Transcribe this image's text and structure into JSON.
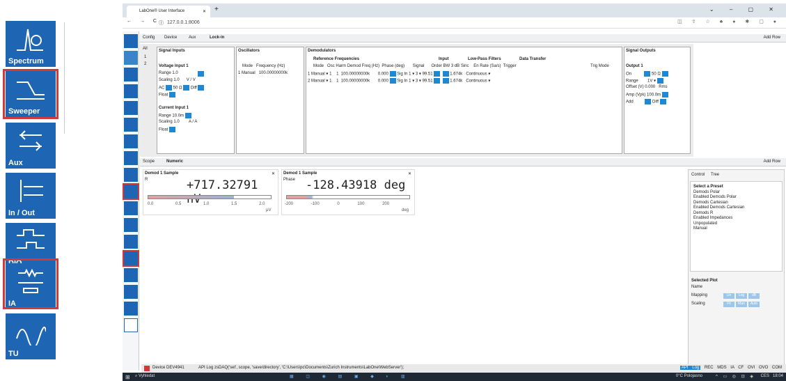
{
  "zoom_sidebar": {
    "items": [
      {
        "label": "Spectrum",
        "icon": "spectrum-icon",
        "highlighted": false
      },
      {
        "label": "Sweeper",
        "icon": "sweeper-icon",
        "highlighted": true
      },
      {
        "label": "Aux",
        "icon": "aux-icon",
        "highlighted": false
      },
      {
        "label": "In / Out",
        "icon": "in-out-icon",
        "highlighted": false
      },
      {
        "label": "DIO",
        "icon": "dio-icon",
        "highlighted": false
      },
      {
        "label": "IA",
        "icon": "ia-icon",
        "highlighted": true
      },
      {
        "label": "TU",
        "icon": "tu-icon",
        "highlighted": false
      }
    ]
  },
  "browser": {
    "tab_title": "LabOne® User Interface",
    "url": "127.0.0.1:8006"
  },
  "top_tabs": {
    "items": [
      "Config",
      "Device",
      "Aux",
      "Lock-in"
    ],
    "add_row": "Add Row"
  },
  "lockin": {
    "all": "All",
    "row1": "1",
    "row2": "2",
    "signal_inputs": {
      "title": "Signal Inputs",
      "voltage_input": "Voltage Input 1",
      "range_label": "Range",
      "range_val": "1.0",
      "scaling_label": "Scaling",
      "scaling_val": "1.0",
      "scaling_unit": "V / V",
      "ac": "AC",
      "ohm": "50 Ω",
      "diff": "Diff",
      "float": "Float",
      "current_input": "Current Input 1",
      "c_range_val": "10.0m",
      "c_scaling_val": "1.0",
      "c_unit": "A / A"
    },
    "oscillators": {
      "title": "Oscillators",
      "mode": "Mode",
      "freq": "Frequency (Hz)",
      "row_mode": "Manual",
      "row_freq": "100.00000000k"
    },
    "demodulators": {
      "title": "Demodulators",
      "ref": "Reference",
      "freqs": "Frequencies",
      "mode": "Mode",
      "osc": "Osc",
      "harm": "Harm",
      "dfreq": "Demod Freq (Hz)",
      "phase": "Phase (deg)",
      "input": "Input",
      "signal": "Signal",
      "lpf": "Low-Pass Filters",
      "order": "Order",
      "bw": "BW 3 dB",
      "sinc": "Sinc",
      "dt": "Data Transfer",
      "en": "En",
      "rate": "Rate (Sa/s)",
      "trigger": "Trigger",
      "trigmode": "Trig Mode",
      "rows": [
        {
          "mode": "Manual",
          "osc": "1",
          "harm": "1",
          "freq": "100.00000000k",
          "phase": "0.000",
          "signal": "Sig In 1",
          "order": "3",
          "bw": "99.51",
          "rate": "1.674k",
          "trig": "Continuous"
        },
        {
          "mode": "Manual",
          "osc": "1",
          "harm": "1",
          "freq": "100.00000000k",
          "phase": "0.000",
          "signal": "Sig In 1",
          "order": "3",
          "bw": "99.51",
          "rate": "1.674k",
          "trig": "Continuous"
        }
      ]
    },
    "signal_outputs": {
      "title": "Signal Outputs",
      "output": "Output 1",
      "on": "On",
      "ohm": "50 Ω",
      "range": "Range",
      "range_val": "1V",
      "offset": "Offset (V)",
      "offset_val": "0.000",
      "rms": "Rms",
      "amp": "Amp (Vpk)",
      "amp_val": "100.0m",
      "add": "Add",
      "diff": "Diff"
    }
  },
  "bottom_tabs": {
    "items": [
      "Scope",
      "Numeric"
    ],
    "add_row": "Add Row"
  },
  "numeric": [
    {
      "title": "Demod 1 Sample",
      "label": "R",
      "value": "+717.32791",
      "unit": "nV",
      "ticks": [
        "0.0",
        "0.5",
        "1.0",
        "1.5",
        "2.0"
      ],
      "axis_unit": "µV"
    },
    {
      "title": "Demod 1 Sample",
      "label": "Phase",
      "value": "-128.43918",
      "unit": "deg",
      "ticks": [
        "-200",
        "-100",
        "0",
        "100",
        "200"
      ],
      "axis_unit": "deg"
    }
  ],
  "right_panel": {
    "tabs": [
      "Control",
      "Tree"
    ],
    "preset_title": "Select a Preset",
    "presets": [
      "Demods Polar",
      "Enabled Demods Polar",
      "Demods Cartesian",
      "Enabled Demods Cartesian",
      "Demods R",
      "Enabled Impedances",
      "Unpopulated",
      "Manual"
    ],
    "selected_plot": "Selected Plot",
    "name": "Name",
    "mapping": "Mapping",
    "scaling": "Scaling",
    "mapping_opts": [
      "Lin",
      "Log",
      "dB"
    ],
    "scaling_opts": [
      "Fit",
      "Man",
      "Auto"
    ]
  },
  "status": {
    "device": "Device",
    "device_id": "DEV4941",
    "api": "API Log",
    "log": "zsDAQ('set', scope, 'save/directory', 'C:\\Users\\pc\\Documents\\Zurich Instruments\\LabOne\\WebServer');",
    "right": [
      "API Log",
      "REC",
      "MDS",
      "IA",
      "CF",
      "OVI",
      "OVO",
      "COM"
    ]
  },
  "taskbar": {
    "search": "Vyhledat",
    "weather": "0°C Polojasno",
    "time": "18:04",
    "lang": "CES"
  }
}
